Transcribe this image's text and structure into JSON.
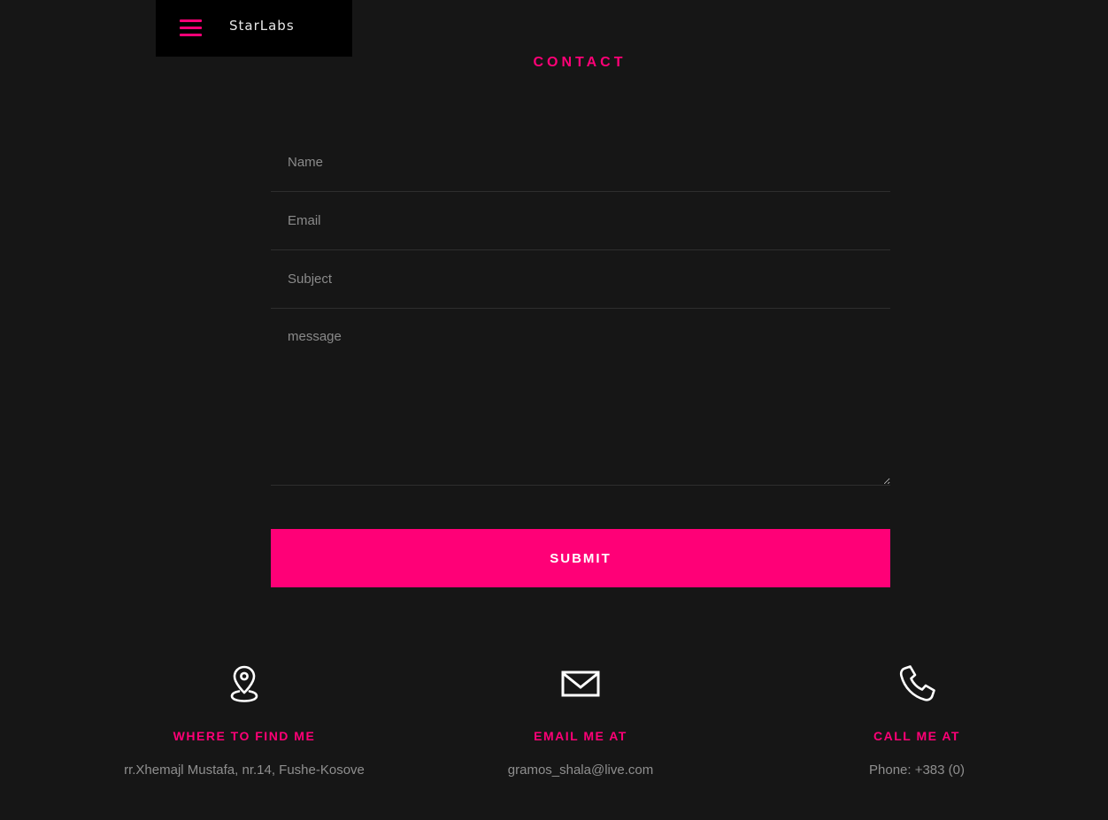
{
  "header": {
    "brand": "StarLabs",
    "menu_icon": "hamburger-menu-icon"
  },
  "contact": {
    "title": "CONTACT",
    "form": {
      "name_placeholder": "Name",
      "email_placeholder": "Email",
      "subject_placeholder": "Subject",
      "message_placeholder": "message",
      "submit_label": "SUBMIT"
    }
  },
  "info": [
    {
      "icon": "location-pin-icon",
      "heading": "WHERE TO FIND ME",
      "value": "rr.Xhemajl Mustafa, nr.14, Fushe-Kosove"
    },
    {
      "icon": "envelope-icon",
      "heading": "EMAIL ME AT",
      "value": "gramos_shala@live.com"
    },
    {
      "icon": "phone-icon",
      "heading": "CALL ME AT",
      "value": "Phone: +383 (0)"
    }
  ],
  "colors": {
    "accent": "#ff0077",
    "background": "#161616",
    "header_background": "#000000"
  }
}
